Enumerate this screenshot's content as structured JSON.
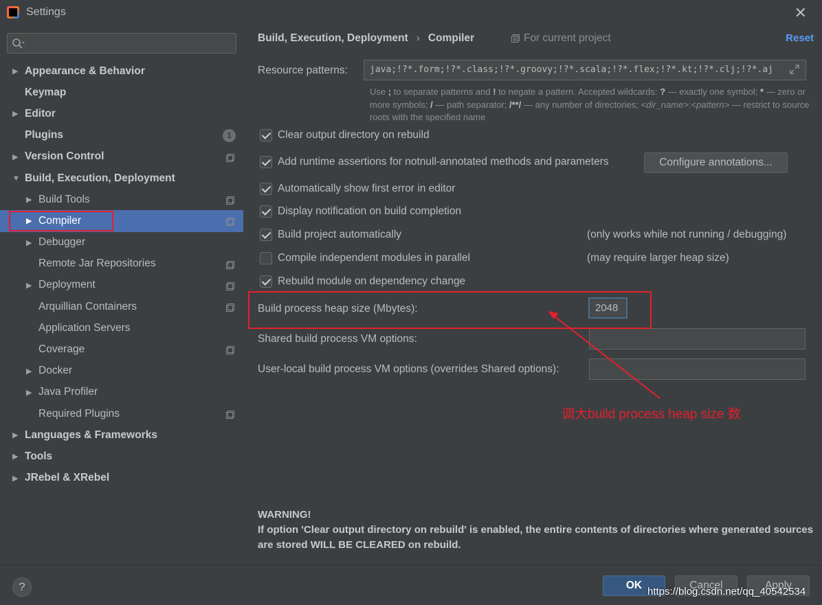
{
  "window": {
    "title": "Settings"
  },
  "sidebar": {
    "search_placeholder": "",
    "items": [
      {
        "label": "Appearance & Behavior",
        "arrow": "▶",
        "bold": true,
        "indent": 0,
        "project": false
      },
      {
        "label": "Keymap",
        "arrow": "",
        "bold": true,
        "indent": 0,
        "project": false
      },
      {
        "label": "Editor",
        "arrow": "▶",
        "bold": true,
        "indent": 0,
        "project": false
      },
      {
        "label": "Plugins",
        "arrow": "",
        "bold": true,
        "indent": 0,
        "project": false,
        "badge": "1"
      },
      {
        "label": "Version Control",
        "arrow": "▶",
        "bold": true,
        "indent": 0,
        "project": true
      },
      {
        "label": "Build, Execution, Deployment",
        "arrow": "▼",
        "bold": true,
        "indent": 0,
        "project": false
      },
      {
        "label": "Build Tools",
        "arrow": "▶",
        "bold": false,
        "indent": 1,
        "project": true
      },
      {
        "label": "Compiler",
        "arrow": "▶",
        "bold": false,
        "indent": 1,
        "project": true,
        "selected": true
      },
      {
        "label": "Debugger",
        "arrow": "▶",
        "bold": false,
        "indent": 1,
        "project": false
      },
      {
        "label": "Remote Jar Repositories",
        "arrow": "",
        "bold": false,
        "indent": 1,
        "project": true
      },
      {
        "label": "Deployment",
        "arrow": "▶",
        "bold": false,
        "indent": 1,
        "project": true
      },
      {
        "label": "Arquillian Containers",
        "arrow": "",
        "bold": false,
        "indent": 1,
        "project": true
      },
      {
        "label": "Application Servers",
        "arrow": "",
        "bold": false,
        "indent": 1,
        "project": false
      },
      {
        "label": "Coverage",
        "arrow": "",
        "bold": false,
        "indent": 1,
        "project": true
      },
      {
        "label": "Docker",
        "arrow": "▶",
        "bold": false,
        "indent": 1,
        "project": false
      },
      {
        "label": "Java Profiler",
        "arrow": "▶",
        "bold": false,
        "indent": 1,
        "project": false
      },
      {
        "label": "Required Plugins",
        "arrow": "",
        "bold": false,
        "indent": 1,
        "project": true
      },
      {
        "label": "Languages & Frameworks",
        "arrow": "▶",
        "bold": true,
        "indent": 0,
        "project": false
      },
      {
        "label": "Tools",
        "arrow": "▶",
        "bold": true,
        "indent": 0,
        "project": false
      },
      {
        "label": "JRebel & XRebel",
        "arrow": "▶",
        "bold": true,
        "indent": 0,
        "project": false
      }
    ]
  },
  "header": {
    "breadcrumb": [
      "Build, Execution, Deployment",
      "Compiler"
    ],
    "breadcrumb_sep": "›",
    "scope": "For current project",
    "reset": "Reset"
  },
  "resource_patterns": {
    "label": "Resource patterns:",
    "value": "java;!?*.form;!?*.class;!?*.groovy;!?*.scala;!?*.flex;!?*.kt;!?*.clj;!?*.aj"
  },
  "hint": {
    "p1": "Use ",
    "semi": ";",
    "p2": " to separate patterns and ",
    "bang": "!",
    "p3": " to negate a pattern. Accepted wildcards: ",
    "q": "?",
    "p4": " — exactly one symbol; ",
    "star": "*",
    "p5": " — zero or more symbols; ",
    "slash": "/",
    "p6": " — path separator; ",
    "dstar": "/**/",
    "p7": " — any number of directories; ",
    "dirname": "<dir_name>",
    "colon": ":",
    "pattern": "<pattern>",
    "p8": " — restrict to source roots with the specified name"
  },
  "checkboxes": [
    {
      "label": "Clear output directory on rebuild",
      "checked": true,
      "note": ""
    },
    {
      "label": "Add runtime assertions for notnull-annotated methods and parameters",
      "checked": true,
      "note": ""
    },
    {
      "label": "Automatically show first error in editor",
      "checked": true,
      "note": ""
    },
    {
      "label": "Display notification on build completion",
      "checked": true,
      "note": ""
    },
    {
      "label": "Build project automatically",
      "checked": true,
      "note": "(only works while not running / debugging)"
    },
    {
      "label": "Compile independent modules in parallel",
      "checked": false,
      "note": "(may require larger heap size)"
    },
    {
      "label": "Rebuild module on dependency change",
      "checked": true,
      "note": ""
    }
  ],
  "configure_button": "Configure annotations...",
  "heap": {
    "label": "Build process heap size (Mbytes):",
    "value": "2048"
  },
  "shared_vm": {
    "label": "Shared build process VM options:",
    "value": ""
  },
  "user_vm": {
    "label": "User-local build process VM options (overrides Shared options):",
    "value": ""
  },
  "annotation": {
    "text": "调大build process heap size 数",
    "color": "#e3202d"
  },
  "warning": {
    "title": "WARNING!",
    "body": "If option 'Clear output directory on rebuild' is enabled, the entire contents of directories where generated sources are stored WILL BE CLEARED on rebuild."
  },
  "footer": {
    "help": "?",
    "ok": "OK",
    "cancel": "Cancel",
    "apply": "Apply",
    "watermark": "https://blog.csdn.net/qq_40542534"
  },
  "colors": {
    "background": "#3c3f41",
    "selection": "#4b6eaf",
    "link": "#589df6",
    "ok_button": "#365880",
    "highlight": "#e3202d"
  }
}
